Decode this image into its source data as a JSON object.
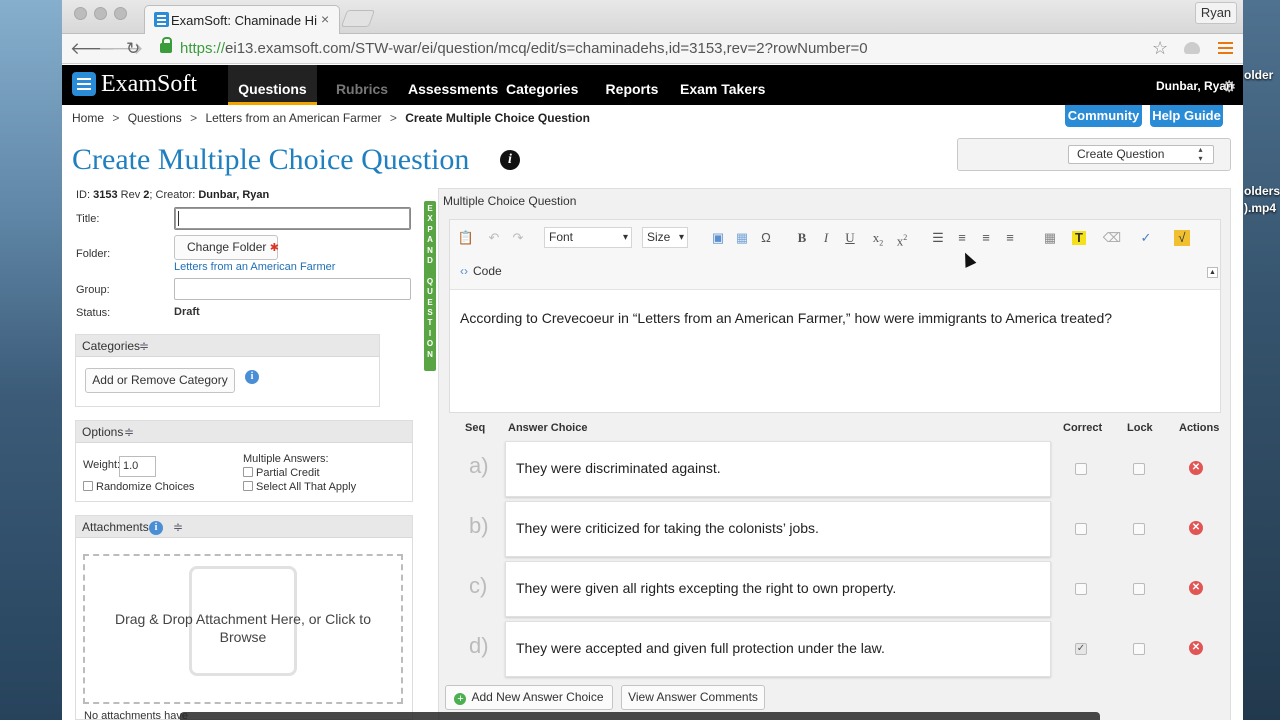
{
  "desktop": {
    "right_text_1": "older",
    "right_text_2": "olders",
    "right_text_3": ").mp4"
  },
  "browser": {
    "tab_title": "ExamSoft: Chaminade High",
    "tab_close": "×",
    "profile": "Ryan",
    "url_scheme": "https://",
    "url_rest": "ei13.examsoft.com/STW-war/ei/question/mcq/edit/s=chaminadehs,id=3153,rev=2?rowNumber=0"
  },
  "app": {
    "logo_text": "ExamSoft",
    "nav": [
      "Questions",
      "Rubrics",
      "Assessments",
      "Categories",
      "Reports",
      "Exam Takers"
    ],
    "user": "Dunbar, Ryan",
    "community": "Community",
    "help_guide": "Help Guide"
  },
  "breadcrumb": [
    "Home",
    "Questions",
    "Letters from an American Farmer",
    "Create Multiple Choice Question"
  ],
  "breadcrumb_sep": ">",
  "page": {
    "title": "Create Multiple Choice Question",
    "create_select": "Create Question"
  },
  "form": {
    "id_label": "ID:",
    "id_value": "3153",
    "rev_label": "Rev",
    "rev_value": "2",
    "creator_label": "; Creator:",
    "creator_value": "Dunbar, Ryan",
    "title_label": "Title:",
    "title_value": "",
    "folder_label": "Folder:",
    "change_folder": "Change Folder",
    "required_mark": "✱",
    "folder_link": "Letters from an American Farmer",
    "group_label": "Group:",
    "status_label": "Status:",
    "status_value": "Draft"
  },
  "categories": {
    "title": "Categories",
    "add_remove": "Add or Remove Category"
  },
  "options": {
    "title": "Options",
    "weight_label": "Weight:",
    "weight_value": "1.0",
    "randomize": "Randomize Choices",
    "multiple_answers": "Multiple Answers:",
    "partial_credit": "Partial Credit",
    "select_all": "Select All That Apply"
  },
  "attachments": {
    "title": "Attachments",
    "drop_text": "Drag & Drop Attachment Here, or Click to Browse",
    "none_text": "No attachments have"
  },
  "expand": {
    "letters": [
      "E",
      "X",
      "P",
      "A",
      "N",
      "D",
      " ",
      "Q",
      "U",
      "E",
      "S",
      "T",
      "I",
      "O",
      "N"
    ]
  },
  "editor": {
    "panel_title": "Multiple Choice Question",
    "font": "Font",
    "size": "Size",
    "code": "Code",
    "question": "According to Crevecoeur in “Letters from an American Farmer,” how were immigrants to America treated?"
  },
  "answers": {
    "headers": {
      "seq": "Seq",
      "choice": "Answer Choice",
      "correct": "Correct",
      "lock": "Lock",
      "actions": "Actions"
    },
    "rows": [
      {
        "letter": "a)",
        "text": "They were discriminated against.",
        "correct": false
      },
      {
        "letter": "b)",
        "text": "They were criticized for taking the colonists’ jobs.",
        "correct": false
      },
      {
        "letter": "c)",
        "text": "They were given all rights excepting the right to own property.",
        "correct": false
      },
      {
        "letter": "d)",
        "text": "They were accepted and given full protection under the law.",
        "correct": true
      }
    ],
    "add_new": "Add New Answer Choice",
    "view_comments": "View Answer Comments"
  },
  "colors": {
    "brand_blue": "#2a8bd6",
    "title_blue": "#1f7fbf",
    "active_tab": "#f0a500",
    "expand_green": "#5aa543",
    "delete_red": "#e25555"
  }
}
